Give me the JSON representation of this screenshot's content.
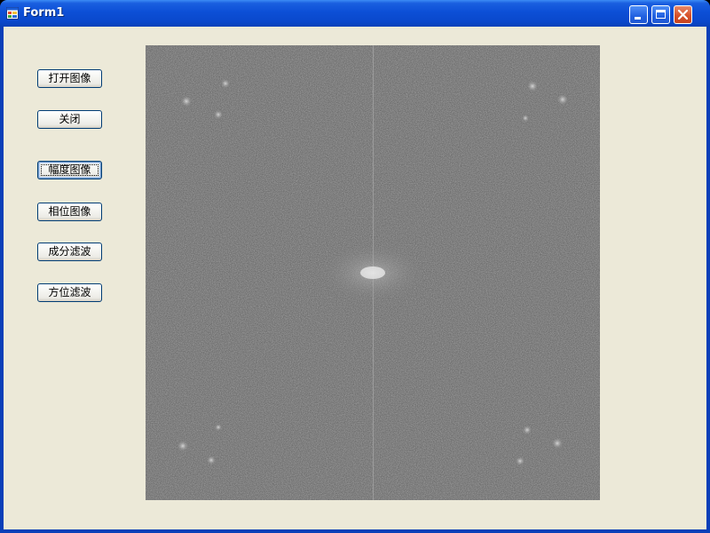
{
  "window": {
    "title": "Form1",
    "title_icon": "app-form-icon",
    "caption_buttons": [
      "minimize-icon",
      "maximize-icon",
      "close-icon"
    ]
  },
  "buttons": {
    "open_image": "打开图像",
    "close": "关闭",
    "magnitude_image": "幅度图像",
    "phase_image": "相位图像",
    "component_filter": "成分滤波",
    "orientation_filter": "方位滤波"
  },
  "picture": {
    "description_type": "fourier-magnitude-spectrum",
    "background_color": "#6b6b6b"
  },
  "colors": {
    "titlebar": "#0c4fd6",
    "client_bg": "#ece9d8",
    "close_button": "#d8522a"
  }
}
